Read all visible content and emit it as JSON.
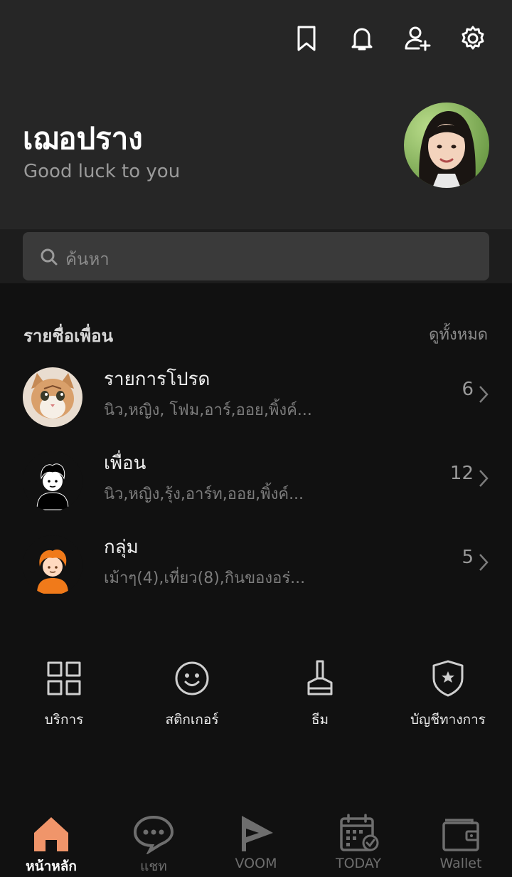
{
  "top_icons": [
    "bookmark-icon",
    "bell-icon",
    "add-friend-icon",
    "gear-icon"
  ],
  "profile": {
    "name": "เฌอปราง",
    "status": "Good luck to you"
  },
  "search": {
    "placeholder": "ค้นหา"
  },
  "friends_section": {
    "title": "รายชื่อเพื่อน",
    "see_all": "ดูทั้งหมด",
    "rows": [
      {
        "title": "รายการโปรด",
        "subtitle": "นิว,หญิง, โฟม,อาร์,ออย,พิ้งค์...",
        "count": "6"
      },
      {
        "title": "เพื่อน",
        "subtitle": "นิว,หญิง,รุ้ง,อาร์ท,ออย,พิ้งค์...",
        "count": "12"
      },
      {
        "title": "กลุ่ม",
        "subtitle": "เม้าๆ(4),เที่ยว(8),กินของอร่...",
        "count": "5"
      }
    ]
  },
  "services": [
    {
      "label": "บริการ",
      "icon": "grid-icon"
    },
    {
      "label": "สติกเกอร์",
      "icon": "smiley-icon"
    },
    {
      "label": "ธีม",
      "icon": "brush-icon"
    },
    {
      "label": "บัญชีทางการ",
      "icon": "shield-star-icon"
    }
  ],
  "bottom_nav": [
    {
      "label": "หน้าหลัก",
      "icon": "home-icon",
      "active": true
    },
    {
      "label": "แชท",
      "icon": "chat-icon",
      "active": false
    },
    {
      "label": "VOOM",
      "icon": "voom-icon",
      "active": false
    },
    {
      "label": "TODAY",
      "icon": "calendar-icon",
      "active": false
    },
    {
      "label": "Wallet",
      "icon": "wallet-icon",
      "active": false
    }
  ],
  "colors": {
    "header_bg": "#262626",
    "body_bg": "#111111",
    "search_bg": "#3a3a3a",
    "active_nav": "#f0956a"
  }
}
